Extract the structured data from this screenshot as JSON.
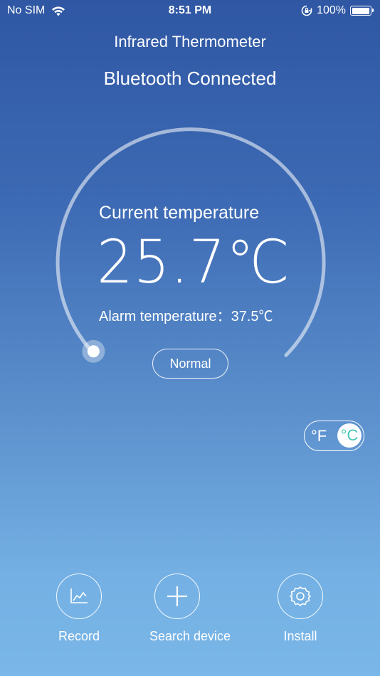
{
  "status_bar": {
    "carrier": "No SIM",
    "time": "8:51 PM",
    "battery": "100%",
    "battery_level": 1.0
  },
  "header": {
    "title": "Infrared Thermometer",
    "connection": "Bluetooth Connected"
  },
  "gauge": {
    "current_label": "Current temperature",
    "current_value": "25.7℃",
    "alarm_label": "Alarm temperature：37.5℃",
    "status": "Normal",
    "level": 0.0
  },
  "unit_toggle": {
    "f_label": "°F",
    "c_label": "°C",
    "selected": "°C"
  },
  "bottom_nav": [
    {
      "label": "Record",
      "icon": "chart-icon"
    },
    {
      "label": "Search device",
      "icon": "plus-icon"
    },
    {
      "label": "Install",
      "icon": "gear-icon"
    }
  ],
  "colors": {
    "toggle_accent": "#49c7b6"
  }
}
